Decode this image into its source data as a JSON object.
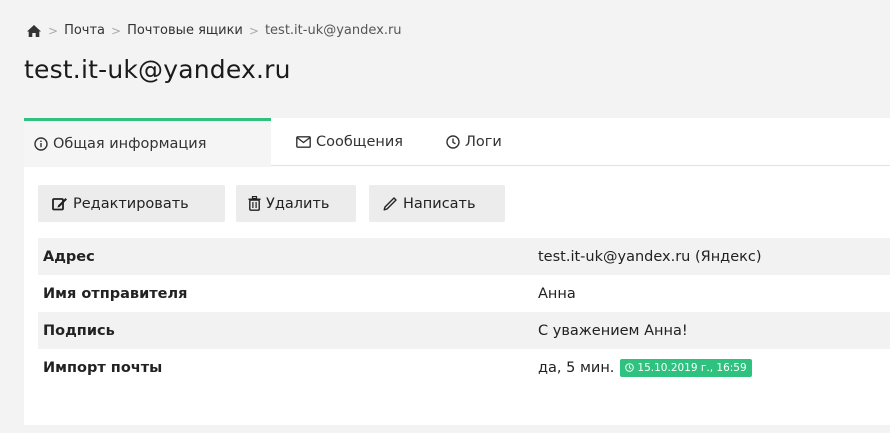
{
  "breadcrumb": {
    "home_icon": "home-icon",
    "items": [
      "Почта",
      "Почтовые ящики",
      "test.it-uk@yandex.ru"
    ],
    "separator": ">"
  },
  "page_title": "test.it-uk@yandex.ru",
  "tabs": [
    {
      "label": "Общая информация",
      "icon": "info-circle-icon",
      "active": true
    },
    {
      "label": "Сообщения",
      "icon": "envelope-icon",
      "active": false
    },
    {
      "label": "Логи",
      "icon": "clock-icon",
      "active": false
    }
  ],
  "toolbar": {
    "edit_label": "Редактировать",
    "delete_label": "Удалить",
    "write_label": "Написать"
  },
  "info_rows": [
    {
      "label": "Адрес",
      "value": "test.it-uk@yandex.ru (Яндекс)"
    },
    {
      "label": "Имя отправителя",
      "value": "Анна"
    },
    {
      "label": "Подпись",
      "value": "С уважением Анна!"
    },
    {
      "label": "Импорт почты",
      "value": "да, 5 мин.",
      "badge": "15.10.2019 г., 16:59"
    }
  ],
  "colors": {
    "accent": "#2ec27e",
    "button_bg": "#ececec",
    "row_alt_bg": "#f2f2f2"
  }
}
